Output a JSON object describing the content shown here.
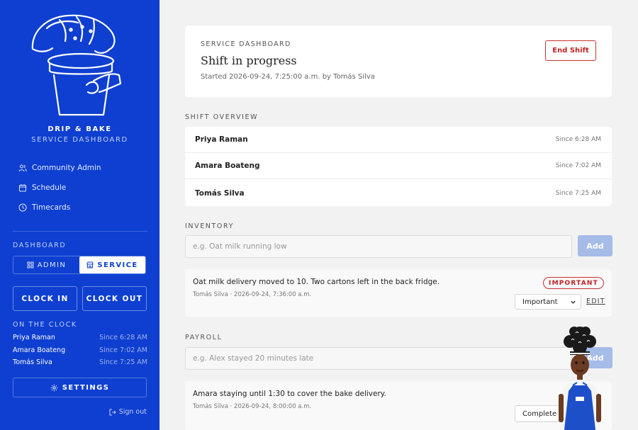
{
  "sidebar": {
    "brand_name": "DRIP & BAKE",
    "brand_subtitle": "SERVICE DASHBOARD",
    "nav": [
      {
        "label": "Community Admin",
        "icon": "users-icon"
      },
      {
        "label": "Schedule",
        "icon": "calendar-icon"
      },
      {
        "label": "Timecards",
        "icon": "clock-icon"
      }
    ],
    "dashboard_label": "DASHBOARD",
    "toggle": {
      "admin_label": "ADMIN",
      "service_label": "SERVICE",
      "active": "service"
    },
    "clock_in_label": "CLOCK IN",
    "clock_out_label": "CLOCK OUT",
    "on_the_clock_label": "ON THE CLOCK",
    "on_the_clock": [
      {
        "name": "Priya Raman",
        "since": "Since 6:28 AM"
      },
      {
        "name": "Amara Boateng",
        "since": "Since 7:02 AM"
      },
      {
        "name": "Tomás Silva",
        "since": "Since 7:25 AM"
      }
    ],
    "settings_label": "SETTINGS",
    "sign_out_label": "Sign out",
    "colors": {
      "background": "#0e3fd0"
    }
  },
  "header": {
    "eyebrow": "SERVICE DASHBOARD",
    "title": "Shift in progress",
    "started": "Started 2026-09-24, 7:25:00 a.m. by Tomás Silva",
    "end_shift_label": "End Shift",
    "colors": {
      "danger": "#c02222"
    }
  },
  "overview": {
    "label": "SHIFT OVERVIEW",
    "rows": [
      {
        "name": "Priya Raman",
        "since": "Since 6:28 AM"
      },
      {
        "name": "Amara Boateng",
        "since": "Since 7:02 AM"
      },
      {
        "name": "Tomás Silva",
        "since": "Since 7:25 AM"
      }
    ]
  },
  "inventory": {
    "label": "INVENTORY",
    "placeholder": "e.g. Oat milk running low",
    "add_label": "Add",
    "note": {
      "text": "Oat milk delivery moved to 10. Two cartons left in the back fridge.",
      "meta": "Tomás Silva · 2026-09-24, 7:36:00 a.m.",
      "badge": "IMPORTANT",
      "priority": "Important",
      "edit_label": "EDIT"
    }
  },
  "payroll": {
    "label": "PAYROLL",
    "placeholder": "e.g. Alex stayed 20 minutes late",
    "add_label": "Add",
    "note": {
      "text": "Amara staying until 1:30 to cover the bake delivery.",
      "meta": "Tomás Silva · 2026-09-24, 8:00:00 a.m.",
      "status": "Complete"
    }
  }
}
